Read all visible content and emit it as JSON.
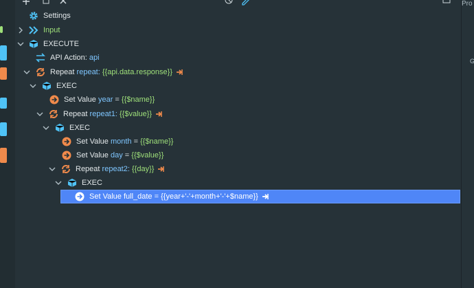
{
  "colors": {
    "background": "#263238",
    "selection": "#4f86f7",
    "icon_cyan": "#4fc3f7",
    "icon_orange": "#f08a4b",
    "text_blue": "#7fc6ff",
    "text_green": "#9fe07a"
  },
  "right_panel": {
    "header": "Pro",
    "g_label": "G"
  },
  "tree": {
    "settings": {
      "label": "Settings",
      "icon": "gear-icon"
    },
    "input": {
      "label": "Input",
      "icon": "double-chevron-icon"
    },
    "execute": {
      "label": "EXECUTE",
      "icon": "cube-icon"
    },
    "api_action": {
      "prefix": "API Action:",
      "name": "api",
      "icon": "exchange-arrows-icon"
    },
    "repeat": {
      "prefix": "Repeat",
      "name": "repeat:",
      "expr": "{{api.data.response}}",
      "icon": "repeat-icon"
    },
    "exec1": {
      "label": "EXEC"
    },
    "set_year": {
      "prefix": "Set Value",
      "name": "year",
      "eq": "=",
      "expr": "{{$name}}"
    },
    "repeat1": {
      "prefix": "Repeat",
      "name": "repeat1:",
      "expr": "{{$value}}"
    },
    "exec2": {
      "label": "EXEC"
    },
    "set_month": {
      "prefix": "Set Value",
      "name": "month",
      "eq": "=",
      "expr": "{{$name}}"
    },
    "set_day": {
      "prefix": "Set Value",
      "name": "day",
      "eq": "=",
      "expr": "{{$value}}"
    },
    "repeat2": {
      "prefix": "Repeat",
      "name": "repeat2:",
      "expr": "{{day}}"
    },
    "exec3": {
      "label": "EXEC"
    },
    "set_full_date": {
      "prefix": "Set Value",
      "name": "full_date",
      "eq": "=",
      "expr": "{{year+'-'+month+'-'+$name}}"
    }
  }
}
